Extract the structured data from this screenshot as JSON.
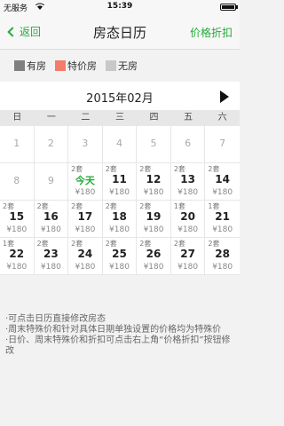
{
  "status": {
    "carrier": "无服务",
    "time": "15:39"
  },
  "nav": {
    "back": "返回",
    "title": "房态日历",
    "right": "价格折扣"
  },
  "legend": [
    {
      "label": "有房",
      "color": "#7f7f7f"
    },
    {
      "label": "特价房",
      "color": "#f47c6a"
    },
    {
      "label": "无房",
      "color": "#c8c8c8"
    }
  ],
  "month": {
    "title": "2015年02月"
  },
  "weekdays": [
    "日",
    "一",
    "二",
    "三",
    "四",
    "五",
    "六"
  ],
  "weeks": [
    [
      {
        "num": "1"
      },
      {
        "num": "2"
      },
      {
        "num": "3"
      },
      {
        "num": "4"
      },
      {
        "num": "5"
      },
      {
        "num": "6"
      },
      {
        "num": "7"
      }
    ],
    [
      {
        "num": "8"
      },
      {
        "num": "9"
      },
      {
        "count": "2套",
        "num": "今天",
        "price": "¥180",
        "today": true
      },
      {
        "count": "2套",
        "num": "11",
        "price": "¥180"
      },
      {
        "count": "2套",
        "num": "12",
        "price": "¥180"
      },
      {
        "count": "2套",
        "num": "13",
        "price": "¥180"
      },
      {
        "count": "2套",
        "num": "14",
        "price": "¥180"
      }
    ],
    [
      {
        "count": "2套",
        "num": "15",
        "price": "¥180"
      },
      {
        "count": "2套",
        "num": "16",
        "price": "¥180"
      },
      {
        "count": "2套",
        "num": "17",
        "price": "¥180"
      },
      {
        "count": "2套",
        "num": "18",
        "price": "¥180"
      },
      {
        "count": "2套",
        "num": "19",
        "price": "¥180"
      },
      {
        "count": "1套",
        "num": "20",
        "price": "¥180"
      },
      {
        "count": "1套",
        "num": "21",
        "price": "¥180"
      }
    ],
    [
      {
        "count": "1套",
        "num": "22",
        "price": "¥180"
      },
      {
        "count": "2套",
        "num": "23",
        "price": "¥180"
      },
      {
        "count": "2套",
        "num": "24",
        "price": "¥180"
      },
      {
        "count": "2套",
        "num": "25",
        "price": "¥180"
      },
      {
        "count": "2套",
        "num": "26",
        "price": "¥180"
      },
      {
        "count": "2套",
        "num": "27",
        "price": "¥180"
      },
      {
        "count": "2套",
        "num": "28",
        "price": "¥180"
      }
    ]
  ],
  "notes": [
    "·可点击日历直接修改房态",
    "·周末特殊价和针对具体日期单独设置的价格均为特殊价",
    "·日价、周末特殊价和折扣可点击右上角“价格折扣”按钮修改"
  ]
}
